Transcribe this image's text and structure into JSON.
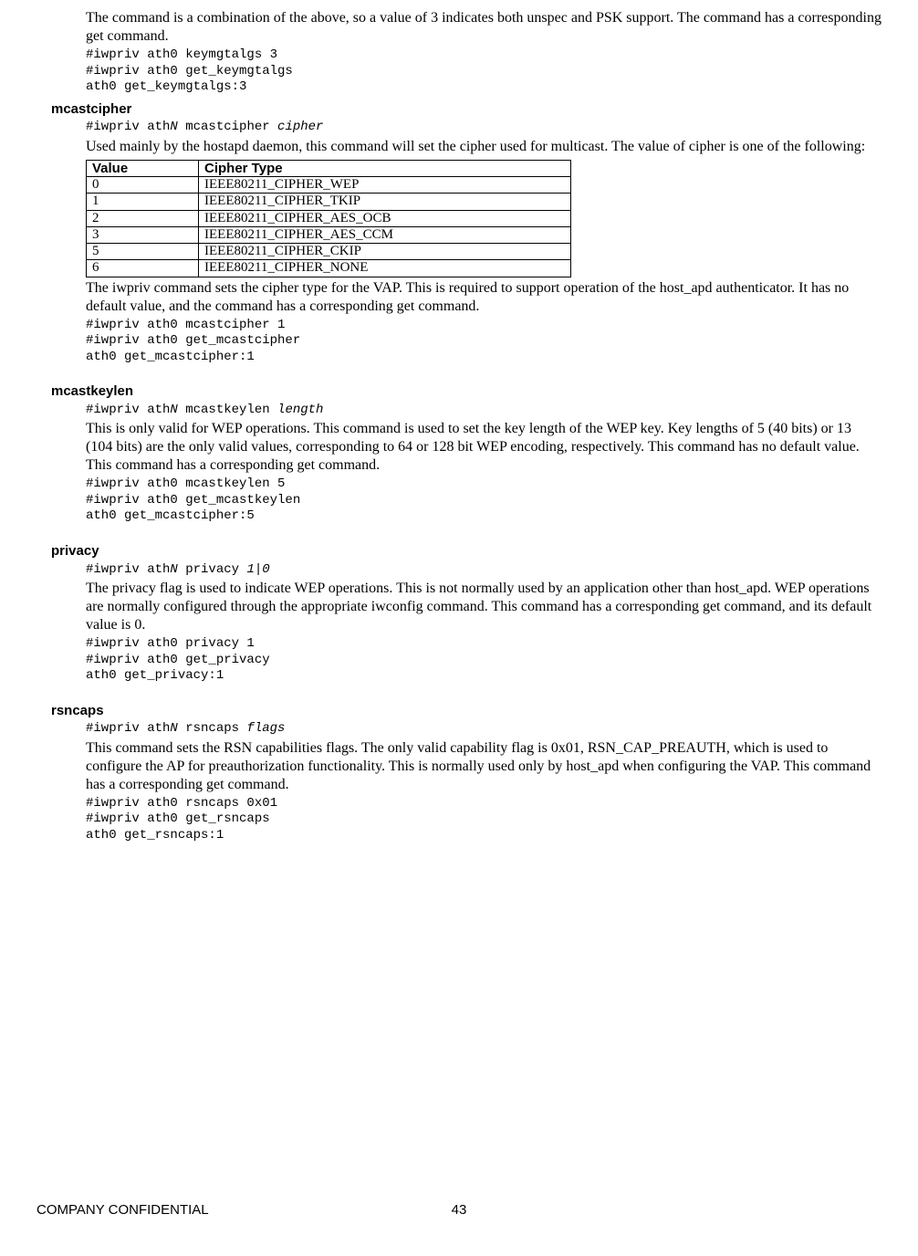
{
  "intro": {
    "p1": "The command is a combination of the above, so a value of 3 indicates both unspec and PSK support. The command has a corresponding get command.",
    "code1": "#iwpriv ath0 keymgtalgs 3\n#iwpriv ath0 get_keymgtalgs\nath0 get_keymgtalgs:3"
  },
  "mcastcipher": {
    "heading": "mcastcipher",
    "cmd_prefix": "#iwpriv ath",
    "cmd_n": "N",
    "cmd_mid": " mcastcipher ",
    "cmd_arg": "cipher",
    "p1": "Used mainly by the hostapd daemon, this command will set the cipher used for multicast. The value of cipher is one of the following:",
    "table": {
      "headers": [
        "Value",
        "Cipher Type"
      ],
      "rows": [
        [
          "0",
          "IEEE80211_CIPHER_WEP"
        ],
        [
          "1",
          "IEEE80211_CIPHER_TKIP"
        ],
        [
          "2",
          "IEEE80211_CIPHER_AES_OCB"
        ],
        [
          "3",
          "IEEE80211_CIPHER_AES_CCM"
        ],
        [
          "5",
          "IEEE80211_CIPHER_CKIP"
        ],
        [
          "6",
          "IEEE80211_CIPHER_NONE"
        ]
      ]
    },
    "p2": "The iwpriv command sets the cipher type for the VAP. This is required to support operation of the host_apd authenticator. It has no default value, and the command has a corresponding get command.",
    "code1": "#iwpriv ath0 mcastcipher 1\n#iwpriv ath0 get_mcastcipher\nath0 get_mcastcipher:1"
  },
  "mcastkeylen": {
    "heading": "mcastkeylen",
    "cmd_prefix": "#iwpriv ath",
    "cmd_n": "N",
    "cmd_mid": " mcastkeylen ",
    "cmd_arg": "length",
    "p1": "This is only valid for WEP operations. This command is used to set the key length of the WEP key. Key lengths of 5 (40 bits) or 13 (104 bits) are the only valid values, corresponding to 64 or 128 bit WEP encoding, respectively. This command has no default value. This command has a corresponding get command.",
    "code1": "#iwpriv ath0 mcastkeylen 5\n#iwpriv ath0 get_mcastkeylen\nath0 get_mcastcipher:5"
  },
  "privacy": {
    "heading": "privacy",
    "cmd_prefix": "#iwpriv ath",
    "cmd_n": "N",
    "cmd_mid": " privacy ",
    "cmd_arg": "1|0",
    "p1": "The privacy flag is used to indicate WEP operations. This is not normally used by an application other than host_apd. WEP operations are normally configured through the appropriate iwconfig command. This command has a corresponding get command, and its default value is 0.",
    "code1": "#iwpriv ath0 privacy 1\n#iwpriv ath0 get_privacy\nath0 get_privacy:1"
  },
  "rsncaps": {
    "heading": "rsncaps",
    "cmd_prefix": "#iwpriv ath",
    "cmd_n": "N",
    "cmd_mid": " rsncaps ",
    "cmd_arg": "flags",
    "p1": "This command sets the RSN capabilities flags. The only valid capability flag is 0x01, RSN_CAP_PREAUTH, which is used to configure the AP for preauthorization functionality. This is normally used only by host_apd when configuring the VAP. This command has a corresponding get command.",
    "code1": "#iwpriv ath0 rsncaps 0x01\n#iwpriv ath0 get_rsncaps\nath0 get_rsncaps:1"
  },
  "footer": {
    "left": "COMPANY CONFIDENTIAL",
    "page": "43"
  }
}
